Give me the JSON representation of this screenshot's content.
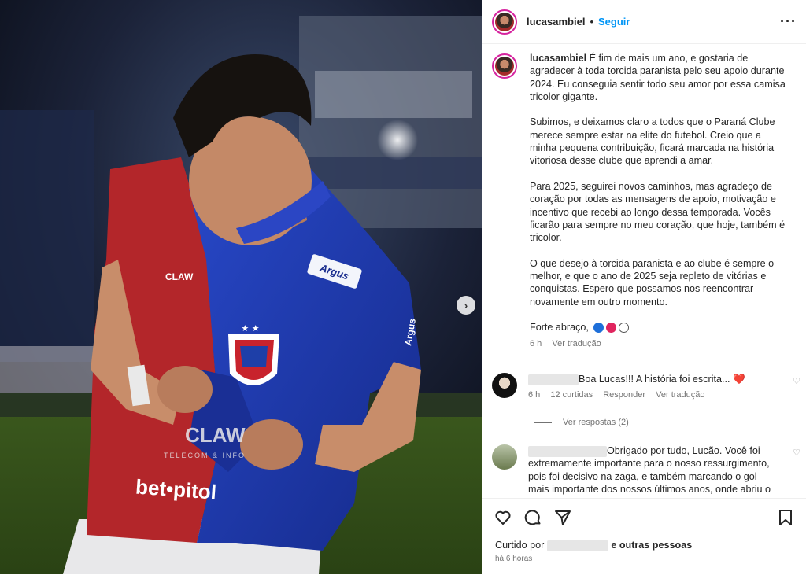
{
  "post": {
    "username": "lucasambiel",
    "separator": "•",
    "follow_label": "Seguir",
    "more_icon": "more-options-icon",
    "image_next_icon": "chevron-right-icon"
  },
  "caption": {
    "username": "lucasambiel",
    "paragraph1": "É fim de mais um ano, e gostaria de agradecer à toda torcida paranista pelo seu apoio durante 2024. Eu conseguia sentir todo seu amor por essa camisa tricolor gigante.",
    "paragraph2": "Subimos, e deixamos claro a todos que o Paraná Clube merece sempre estar na elite do futebol. Creio que a minha pequena contribuição, ficará marcada na história vitoriosa desse clube que aprendi a amar.",
    "paragraph3": "Para 2025, seguirei novos caminhos, mas agradeço de coração por todas as mensagens de apoio, motivação e incentivo que recebi ao longo dessa temporada. Vocês ficarão para sempre no meu coração, que hoje, também é tricolor.",
    "paragraph4": "O que desejo à torcida paranista e ao clube é sempre o melhor, e que o ano de 2025 seja repleto de vitórias e conquistas. Espero que possamos nos reencontrar novamente em outro momento.",
    "closing": "Forte abraço,",
    "heart_colors": [
      "#1e6fd9",
      "#e0245e",
      "#ffffff"
    ],
    "time": "6 h",
    "translate": "Ver tradução"
  },
  "comments": [
    {
      "text": "Boa Lucas!!! A história foi escrita...",
      "emoji": "❤️",
      "time": "6 h",
      "likes": "12 curtidas",
      "reply": "Responder",
      "translate": "Ver tradução",
      "view_replies": "Ver respostas (2)"
    },
    {
      "text": "Obrigado por tudo, Lucão. Você foi extremamente importante para o nosso ressurgimento, pois foi decisivo na zaga, e também marcando o gol mais importante dos nossos últimos anos, onde abriu o"
    }
  ],
  "footer": {
    "liked_prefix": "Curtido por",
    "liked_suffix": "e outras pessoas",
    "time": "há 6 horas"
  },
  "photo_text": {
    "sponsor_chest": "bet•pitol",
    "sponsor_shoulder": "Argus",
    "sponsor_sleeve": "Argus",
    "sponsor_mid": "CLAW",
    "sponsor_sub": "TELECOM & INFO"
  },
  "colors": {
    "follow": "#0095f6",
    "jersey_blue": "#1f3fb0",
    "jersey_red": "#b3262a"
  }
}
